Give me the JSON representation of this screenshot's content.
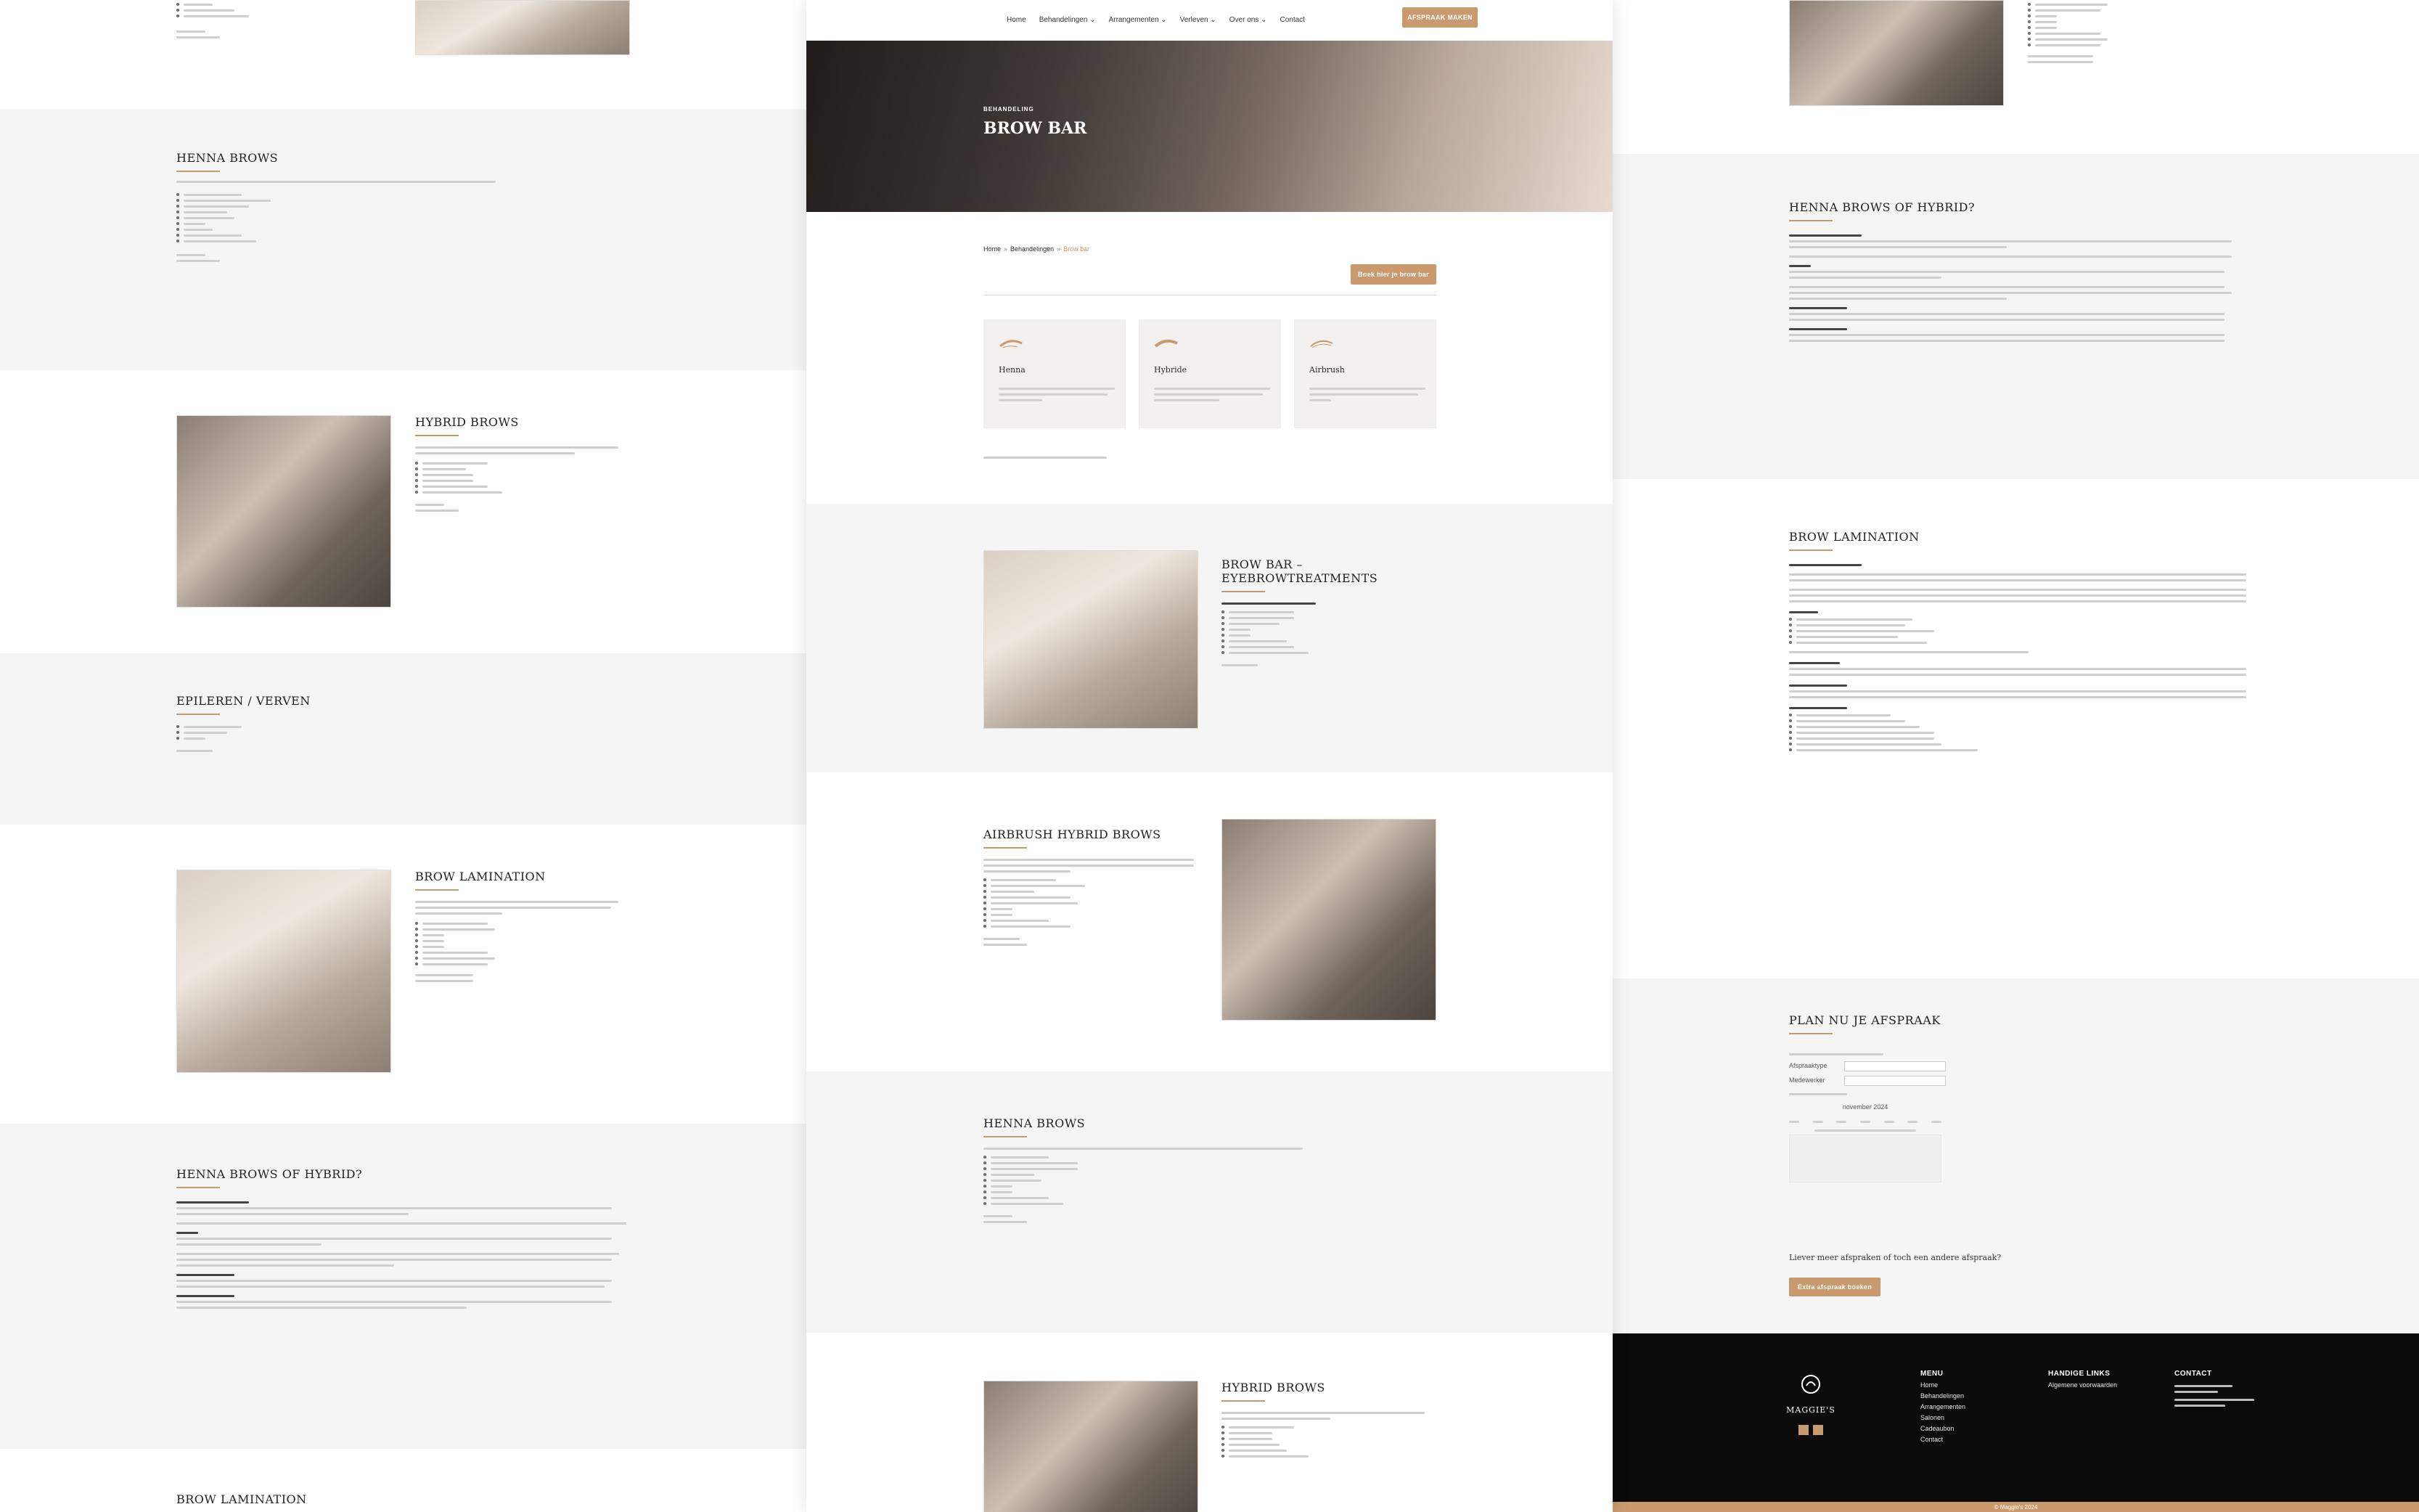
{
  "nav": {
    "items": [
      "Home",
      "Behandelingen ⌄",
      "Arrangementen ⌄",
      "Verleven ⌄",
      "Over ons ⌄",
      "Contact"
    ],
    "cta": "AFSPRAAK MAKEN"
  },
  "hero": {
    "eyebrow": "BEHANDELING",
    "title": "BROW BAR"
  },
  "breadcrumb": {
    "home": "Home",
    "sep1": "»",
    "mid": "Behandelingen",
    "sep2": "»",
    "current": "Brow bar"
  },
  "book_button": "Boek hier je brow bar",
  "cards": [
    {
      "title": "Henna"
    },
    {
      "title": "Hybride"
    },
    {
      "title": "Airbrush"
    }
  ],
  "sections": {
    "browbar_title": "BROW BAR – EYEBROWTREATMENTS",
    "airbrush_title": "AIRBRUSH HYBRID BROWS",
    "henna_title": "HENNA BROWS",
    "hybrid_title": "HYBRID BROWS",
    "epileren_title": "EPILEREN / VERVEN",
    "lamination_title": "BROW LAMINATION",
    "henna_or_hybrid_title": "HENNA BROWS OF HYBRID?",
    "plan_title": "PLAN NU JE AFSPRAAK",
    "extra_question": "Liever meer afspraken of toch een andere afspraak?",
    "extra_button": "Extra afspraak boeken"
  },
  "booking": {
    "label1": "Afspraaktype",
    "label2": "Medewerker",
    "month": "november 2024"
  },
  "footer": {
    "brand": "MAGGIE'S",
    "menu_head": "MENU",
    "menu": [
      "Home",
      "Behandelingen",
      "Arrangementen",
      "Salonen",
      "Cadeaubon",
      "Contact"
    ],
    "links_head": "HANDIGE LINKS",
    "links": [
      "Algemene voorwaarden"
    ],
    "contact_head": "CONTACT",
    "copyright": "© Maggie's 2024"
  },
  "colors": {
    "accent": "#c89a6e",
    "footer_bg": "#0b0b0b",
    "band_grey": "#f5f5f5"
  }
}
